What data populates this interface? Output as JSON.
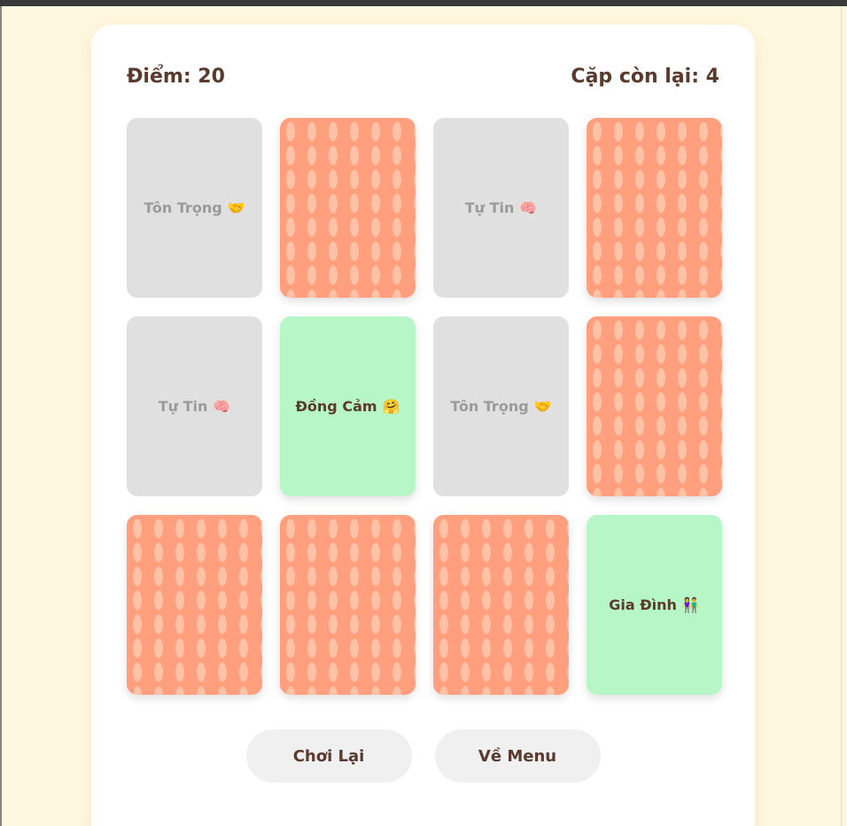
{
  "header": {
    "score_label": "Điểm: 20",
    "pairs_left_label": "Cặp còn lại: 4"
  },
  "cards": [
    {
      "state": "matched",
      "label": "Tôn Trọng",
      "emoji": "🤝"
    },
    {
      "state": "hidden",
      "label": "",
      "emoji": ""
    },
    {
      "state": "matched",
      "label": "Tự Tin",
      "emoji": "🧠"
    },
    {
      "state": "hidden",
      "label": "",
      "emoji": ""
    },
    {
      "state": "matched",
      "label": "Tự Tin",
      "emoji": "🧠"
    },
    {
      "state": "revealed",
      "label": "Đồng Cảm",
      "emoji": "🤗"
    },
    {
      "state": "matched",
      "label": "Tôn Trọng",
      "emoji": "🤝"
    },
    {
      "state": "hidden",
      "label": "",
      "emoji": ""
    },
    {
      "state": "hidden",
      "label": "",
      "emoji": ""
    },
    {
      "state": "hidden",
      "label": "",
      "emoji": ""
    },
    {
      "state": "hidden",
      "label": "",
      "emoji": ""
    },
    {
      "state": "revealed",
      "label": "Gia Đình",
      "emoji": "👫"
    }
  ],
  "buttons": {
    "replay_label": "Chơi Lại",
    "menu_label": "Về Menu"
  },
  "colors": {
    "background": "#fff8e1",
    "card_back": "#ff9f7e",
    "card_matched": "#e0e0e0",
    "card_revealed": "#b7f6c7",
    "text": "#5b3a2e"
  }
}
